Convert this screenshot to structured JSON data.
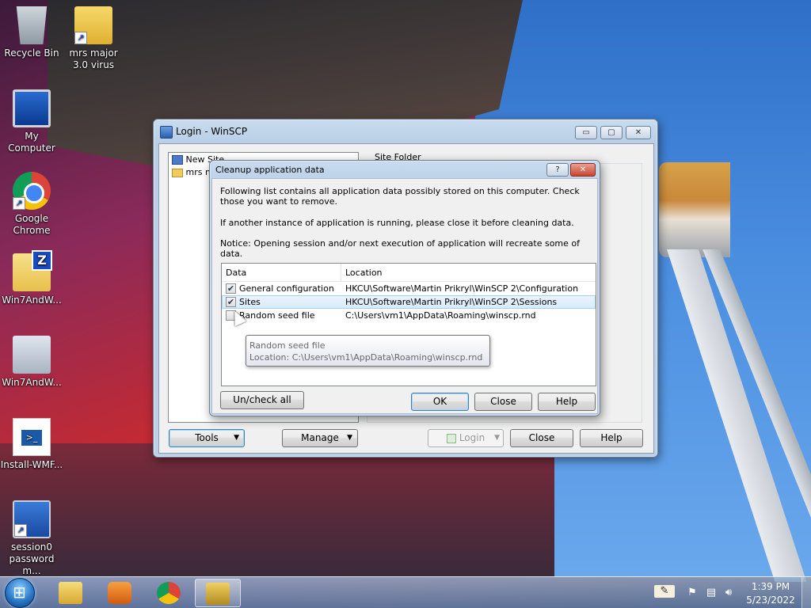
{
  "desktop": {
    "icons": [
      {
        "label": "Recycle Bin"
      },
      {
        "label": "mrs major 3.0 virus"
      },
      {
        "label": "My Computer"
      },
      {
        "label": "Google Chrome"
      },
      {
        "label": "Win7AndW..."
      },
      {
        "label": "Win7AndW..."
      },
      {
        "label": "Install-WMF..."
      },
      {
        "label": "session0 password m..."
      }
    ]
  },
  "winscp": {
    "title": "Login - WinSCP",
    "tree": {
      "items": [
        {
          "label": "New Site"
        },
        {
          "label": "mrs m"
        }
      ]
    },
    "site_folder_label": "Site Folder",
    "buttons": {
      "tools": "Tools",
      "manage": "Manage",
      "login": "Login",
      "close": "Close",
      "help": "Help"
    },
    "caption": {
      "minimize": "▭",
      "maximize": "▢",
      "close": "✕"
    }
  },
  "dialog": {
    "title": "Cleanup application data",
    "help_caption": "?",
    "close_caption": "✕",
    "text1": "Following list contains all application data possibly stored on this computer. Check those you want to remove.",
    "text2": "If another instance of application is running, please close it before cleaning data.",
    "text3": "Notice: Opening session and/or next execution of application will recreate some of data.",
    "columns": {
      "data": "Data",
      "location": "Location"
    },
    "rows": [
      {
        "data": "General configuration",
        "location": "HKCU\\Software\\Martin Prikryl\\WinSCP 2\\Configuration",
        "checked": "✔"
      },
      {
        "data": "Sites",
        "location": "HKCU\\Software\\Martin Prikryl\\WinSCP 2\\Sessions",
        "checked": "✔"
      },
      {
        "data": "Random seed file",
        "location": "C:\\Users\\vm1\\AppData\\Roaming\\winscp.rnd",
        "checked": ""
      }
    ],
    "tooltip": {
      "line1": "Random seed file",
      "line2": "Location: C:\\Users\\vm1\\AppData\\Roaming\\winscp.rnd"
    },
    "buttons": {
      "uncheck_all": "Un/check all",
      "ok": "OK",
      "close": "Close",
      "help": "Help"
    }
  },
  "taskbar": {
    "time": "1:39 PM",
    "date": "5/23/2022",
    "items": [
      {
        "icon": "folder-icon"
      },
      {
        "icon": "media-player-icon"
      },
      {
        "icon": "chrome-icon"
      },
      {
        "icon": "winscp-icon"
      }
    ]
  }
}
